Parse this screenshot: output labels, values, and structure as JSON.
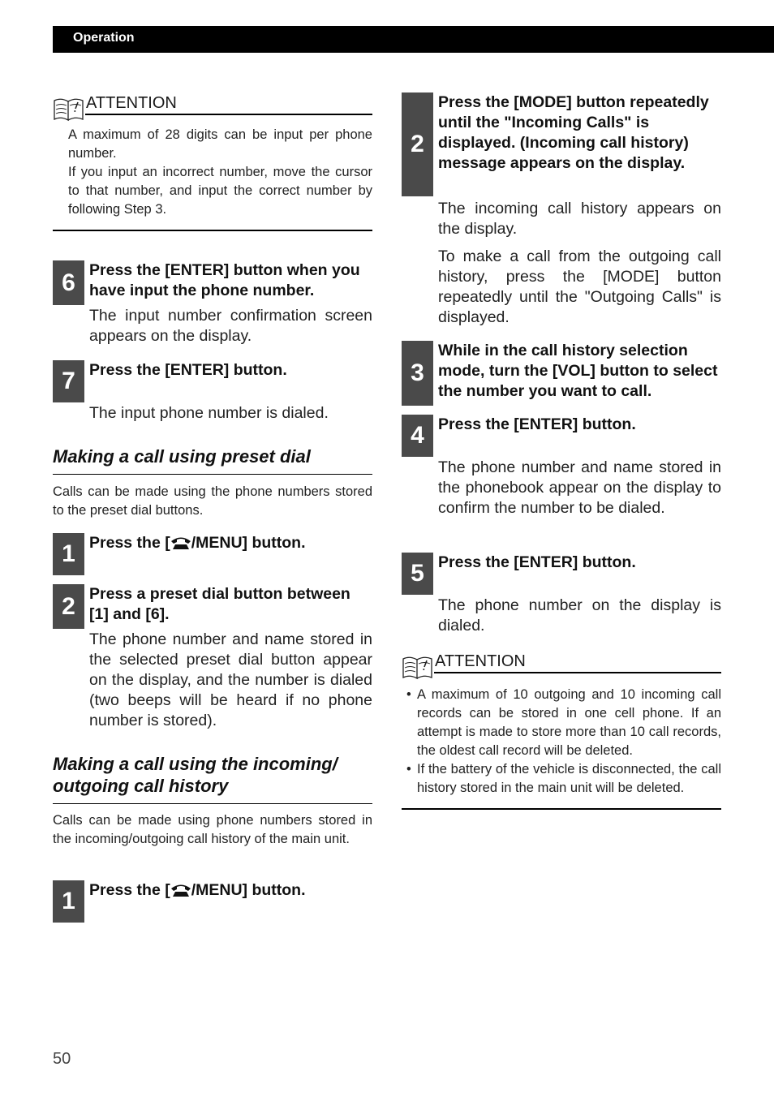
{
  "header": {
    "section_label": "Operation"
  },
  "left": {
    "attention1": {
      "title": "ATTENTION",
      "lines": [
        "A maximum of 28 digits can be input per phone number.",
        "If you input an incorrect number, move the cursor to that number, and input the correct number by following Step 3."
      ]
    },
    "step6": {
      "num": "6",
      "title": "Press the [ENTER] button when you have input the phone number.",
      "body": "The input number confirmation screen appears on the display."
    },
    "step7": {
      "num": "7",
      "title": "Press the [ENTER] button.",
      "body": "The input phone number is dialed."
    },
    "preset_section": {
      "title": "Making a call using preset dial",
      "intro": "Calls can be made using the phone numbers stored to the preset dial buttons.",
      "step1": {
        "num": "1",
        "title_prefix": "Press the [",
        "title_suffix": "/MENU] button."
      },
      "step2": {
        "num": "2",
        "title": "Press a preset dial button between [1] and [6].",
        "body": "The phone number and name stored in the selected preset dial button appear on the display, and the number is dialed (two beeps will be heard if no phone number is stored)."
      }
    },
    "history_section": {
      "title": "Making a call using the incoming/ outgoing call history",
      "intro": "Calls can be made using phone numbers stored in the incoming/outgoing call history of the main unit.",
      "step1": {
        "num": "1",
        "title_prefix": "Press the [",
        "title_suffix": "/MENU] button."
      }
    }
  },
  "right": {
    "step2": {
      "num": "2",
      "title": "Press the [MODE] button repeatedly until the \"Incoming Calls\" is displayed. (Incoming call history) message appears on the display.",
      "body": [
        "The incoming call history appears on the display.",
        "To make a call from the outgoing call history, press the [MODE] button repeatedly until the \"Outgoing Calls\" is displayed."
      ]
    },
    "step3": {
      "num": "3",
      "title": "While in the call history selection mode, turn the [VOL] button to select the number you want to call."
    },
    "step4": {
      "num": "4",
      "title": "Press the [ENTER] button.",
      "body": "The phone number and name stored in the phonebook appear on the display to confirm the number to be dialed."
    },
    "step5": {
      "num": "5",
      "title": "Press the [ENTER] button.",
      "body": "The phone number on the display is dialed."
    },
    "attention2": {
      "title": "ATTENTION",
      "bullets": [
        "A maximum of 10 outgoing and 10 incoming call records can be stored in one cell phone. If an attempt is made to store more than 10 call records, the oldest call record will be deleted.",
        "If the battery of the vehicle is disconnected, the call history stored in the main unit will be deleted."
      ]
    }
  },
  "footer": {
    "page_number": "50"
  }
}
